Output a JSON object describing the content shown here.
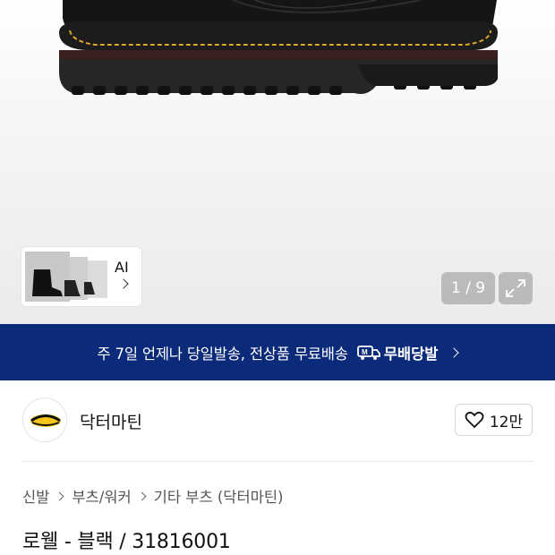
{
  "gallery": {
    "ai_label": "AI",
    "counter": "1 / 9",
    "expand_icon": "expand-icon"
  },
  "banner": {
    "text": "주 7일 언제나 당일발송, 전상품 무료배송",
    "logo_text": "무배당발",
    "bg_color": "#0c2a7a"
  },
  "brand": {
    "name": "닥터마틴",
    "likes": "12만"
  },
  "breadcrumb": [
    "신발",
    "부츠/워커",
    "기타 부츠 (닥터마틴)"
  ],
  "product": {
    "title": "로웰 - 블랙 / 31816001"
  }
}
